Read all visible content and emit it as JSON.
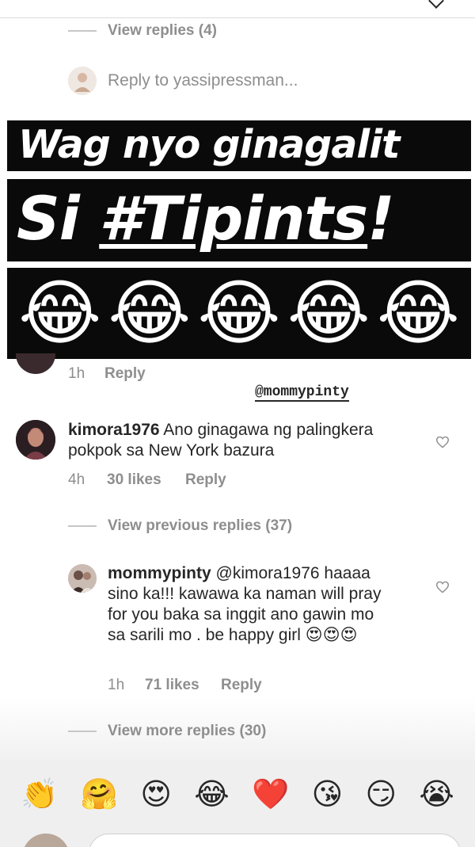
{
  "top": {
    "view_replies_label": "View replies (4)",
    "reply_to_label": "Reply to yassipressman..."
  },
  "overlay": {
    "line1": "Wag nyo ginagalit",
    "line2_prefix": "Si ",
    "line2_tag": "#Tipints",
    "line2_suffix": "!",
    "emojis": [
      "😂",
      "😂",
      "😂",
      "😂",
      "😂"
    ],
    "mention_sticker": "@mommypinty"
  },
  "partial_comment": {
    "time": "1h",
    "reply_label": "Reply"
  },
  "comment_kimora": {
    "username": "kimora1976",
    "text": "Ano ginagawa ng palingkera pokpok sa New York bazura",
    "time": "4h",
    "likes": "30 likes",
    "reply_label": "Reply",
    "view_previous_label": "View previous replies (37)"
  },
  "reply_mommypinty": {
    "username": "mommypinty",
    "mention": "@kimora1976",
    "text": "haaaa sino ka!!! kawawa ka naman will pray for you baka sa inggit ano gawin mo sa sarili mo .  be happy girl",
    "emojis": "😍😍😍",
    "time": "1h",
    "likes": "71 likes",
    "reply_label": "Reply"
  },
  "view_more_label": "View more replies (30)",
  "emoji_bar": [
    "👏",
    "🤗",
    "😍",
    "😂",
    "❤️",
    "😘",
    "😏",
    "😭"
  ],
  "colors": {
    "secondary_text": "#8e8e8e",
    "primary_text": "#262626",
    "banner_bg": "#0a0a0a",
    "bar_bg": "#efefef"
  }
}
